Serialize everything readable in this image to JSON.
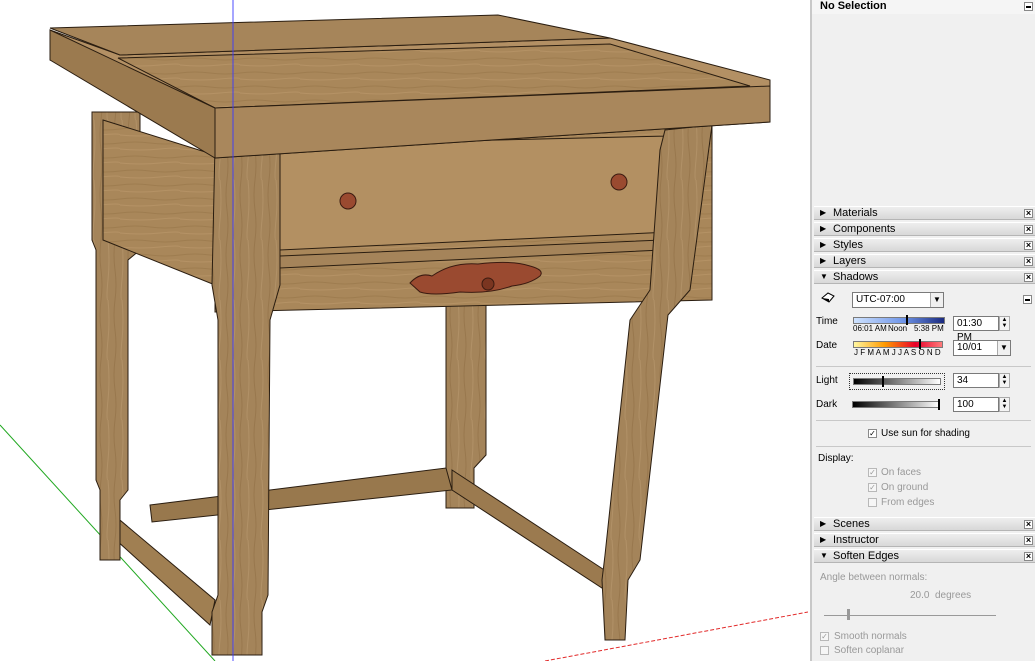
{
  "entity_info": {
    "title": "No Selection"
  },
  "trays": {
    "materials": "Materials",
    "components": "Components",
    "styles": "Styles",
    "layers": "Layers",
    "shadows": "Shadows",
    "scenes": "Scenes",
    "instructor": "Instructor",
    "soften_edges": "Soften Edges"
  },
  "shadows": {
    "timezone": "UTC-07:00",
    "time_label": "Time",
    "time_start": "06:01 AM",
    "time_noon": "Noon",
    "time_end": "5:38 PM",
    "time_value": "01:30 PM",
    "date_label": "Date",
    "months": "J F M A M J J A S O N D",
    "date_value": "10/01",
    "light_label": "Light",
    "light_value": "34",
    "light_fraction": 0.34,
    "dark_label": "Dark",
    "dark_value": "100",
    "dark_fraction": 1.0,
    "use_sun_label": "Use sun for shading",
    "use_sun_checked": true,
    "display_label": "Display:",
    "on_faces_label": "On faces",
    "on_faces_checked": true,
    "on_ground_label": "On ground",
    "on_ground_checked": true,
    "from_edges_label": "From edges",
    "from_edges_checked": false
  },
  "soften_edges": {
    "angle_label": "Angle between normals:",
    "angle_value": "20.0",
    "angle_unit": "degrees",
    "smooth_normals_label": "Smooth normals",
    "smooth_normals_checked": true,
    "soften_coplanar_label": "Soften coplanar",
    "soften_coplanar_checked": false
  },
  "colors": {
    "wood_light": "#b08e60",
    "wood_mid": "#9c7a4e",
    "wood_dark": "#7d5e38",
    "hardware": "#9a4a30",
    "axis_blue": "#3a3aff",
    "axis_green": "#21a821",
    "axis_red": "#e22a2a"
  }
}
